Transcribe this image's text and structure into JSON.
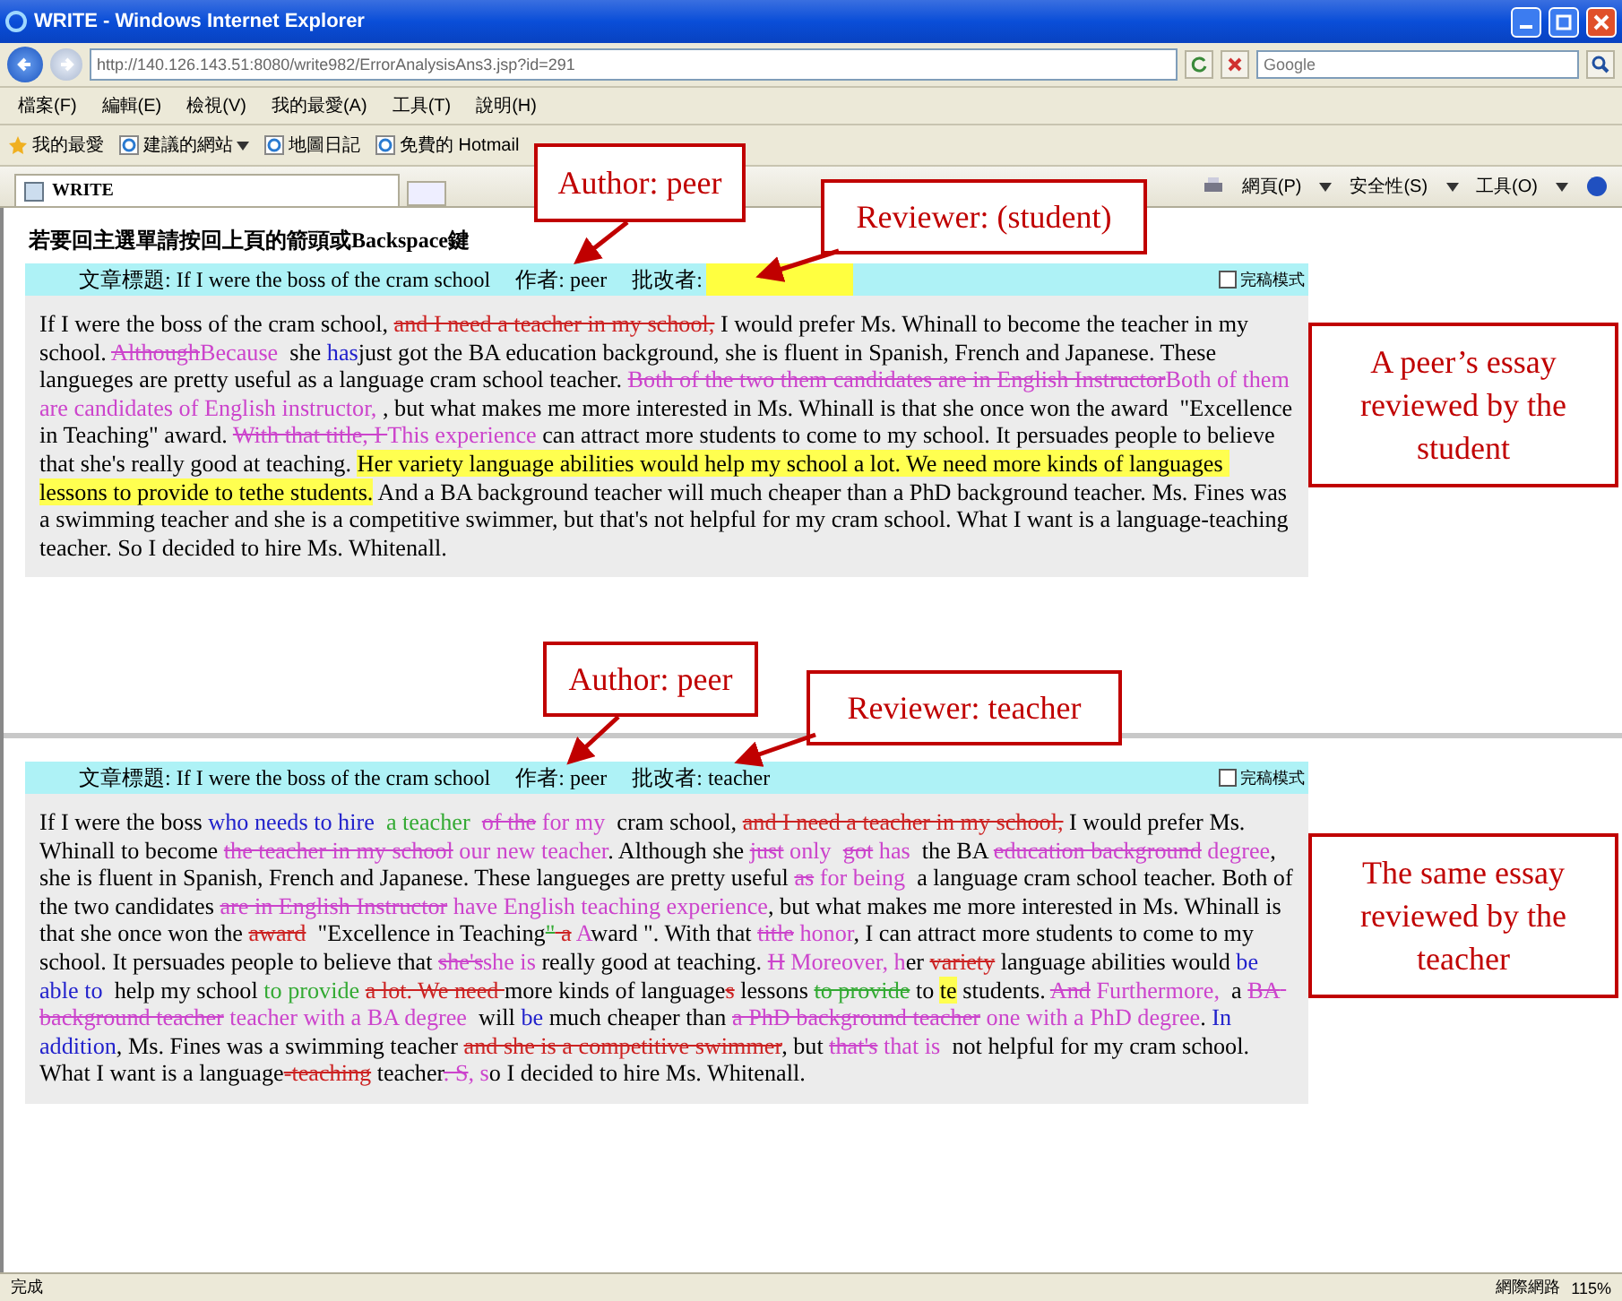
{
  "window": {
    "title": "WRITE - Windows Internet Explorer"
  },
  "address_bar": {
    "url": "http://140.126.143.51:8080/write982/ErrorAnalysisAns3.jsp?id=291"
  },
  "search": {
    "placeholder": "Google"
  },
  "menu": [
    "檔案(F)",
    "編輯(E)",
    "檢視(V)",
    "我的最愛(A)",
    "工具(T)",
    "說明(H)"
  ],
  "favorites": {
    "label": "我的最愛",
    "links": [
      {
        "label": "建議的網站",
        "dropdown": true
      },
      {
        "label": "地圖日記",
        "dropdown": false
      },
      {
        "label": "免費的 Hotmail",
        "dropdown": false
      }
    ]
  },
  "tabs": [
    {
      "label": "WRITE",
      "selected": true
    }
  ],
  "command_bar": [
    "網頁(P)",
    "安全性(S)",
    "工具(O)"
  ],
  "page": {
    "notice": "若要回主選單請按回上頁的箭頭或Backspace鍵",
    "panels": [
      {
        "title_label": "文章標題:",
        "title": "If I were the boss of the cram school",
        "author_label": "作者:",
        "author": "peer",
        "reviewer_label": "批改者:",
        "reviewer_highlighted": true,
        "checkbox": {
          "label": "完稿模式",
          "checked": false
        },
        "essay": [
          {
            "kind": "plain",
            "text": "If I were the boss of the cram school, "
          },
          {
            "kind": "deleted",
            "color": "#cc2222",
            "text": "and I need a teacher in my school,"
          },
          {
            "kind": "plain",
            "text": " I would prefer Ms. Whinall to become the teacher in my school. "
          },
          {
            "kind": "deleted",
            "color": "#cc44cc",
            "text": "Although"
          },
          {
            "kind": "inserted",
            "color": "#cc44cc",
            "text": "Because"
          },
          {
            "kind": "plain",
            "text": "  she "
          },
          {
            "kind": "inserted",
            "color": "#2222cc",
            "text": "has"
          },
          {
            "kind": "plain",
            "text": "just got the BA education background, she is fluent in Spanish, French and Japanese. These langueges are pretty useful as a language cram school teacher. "
          },
          {
            "kind": "deleted",
            "color": "#cc44cc",
            "text": "Both of the two them candidates are in English Instructor"
          },
          {
            "kind": "inserted",
            "color": "#cc44cc",
            "text": "Both of them are candidates of English instructor, "
          },
          {
            "kind": "plain",
            "text": ", but what makes me more interested in Ms. Whinall is that she once won the award  \"Excellence in Teaching\" award. "
          },
          {
            "kind": "deleted",
            "color": "#cc44cc",
            "text": "With that title, I "
          },
          {
            "kind": "inserted",
            "color": "#cc44cc",
            "text": "This experience"
          },
          {
            "kind": "plain",
            "text": " can attract more students to come to my school. It persuades people to believe that she's really good at teaching. "
          },
          {
            "kind": "highlight",
            "text": "Her variety language abilities would help my school a lot. We need more kinds of languages lessons to provide to tethe students."
          },
          {
            "kind": "plain",
            "text": " And a BA background teacher will much cheaper than a PhD background teacher. Ms. Fines was a swimming teacher and she is a competitive swimmer, but that's not helpful for my cram school. What I want is a language-teaching teacher. So I decided to hire Ms. Whitenall."
          }
        ]
      },
      {
        "title_label": "文章標題:",
        "title": "If I were the boss of the cram school",
        "author_label": "作者:",
        "author": "peer",
        "reviewer_label": "批改者:",
        "reviewer": "teacher",
        "reviewer_highlighted": false,
        "checkbox": {
          "label": "完稿模式",
          "checked": false
        },
        "essay": [
          {
            "kind": "plain",
            "text": "If I were the boss "
          },
          {
            "kind": "inserted",
            "color": "#2222cc",
            "text": "who needs to hire"
          },
          {
            "kind": "inserted",
            "color": "#33aa33",
            "text": "  a teacher  "
          },
          {
            "kind": "deleted",
            "color": "#cc44cc",
            "text": "of the"
          },
          {
            "kind": "inserted",
            "color": "#cc44cc",
            "text": " for my"
          },
          {
            "kind": "plain",
            "text": "  cram school, "
          },
          {
            "kind": "deleted",
            "color": "#cc2222",
            "text": "and I need a teacher in my school,"
          },
          {
            "kind": "plain",
            "text": " I would prefer Ms. Whinall to become "
          },
          {
            "kind": "deleted",
            "color": "#cc44cc",
            "text": "the teacher in my school"
          },
          {
            "kind": "inserted",
            "color": "#cc44cc",
            "text": " our new teacher"
          },
          {
            "kind": "plain",
            "text": ". Although she "
          },
          {
            "kind": "deleted",
            "color": "#cc44cc",
            "text": "just"
          },
          {
            "kind": "inserted",
            "color": "#cc44cc",
            "text": " only  "
          },
          {
            "kind": "deleted",
            "color": "#cc44cc",
            "text": "got"
          },
          {
            "kind": "inserted",
            "color": "#cc44cc",
            "text": " has"
          },
          {
            "kind": "plain",
            "text": "  the BA "
          },
          {
            "kind": "deleted",
            "color": "#cc44cc",
            "text": "education background"
          },
          {
            "kind": "inserted",
            "color": "#cc44cc",
            "text": " degree"
          },
          {
            "kind": "plain",
            "text": ", she is fluent in Spanish, French and Japanese. These langueges are pretty useful "
          },
          {
            "kind": "deleted",
            "color": "#cc44cc",
            "text": "as"
          },
          {
            "kind": "inserted",
            "color": "#cc44cc",
            "text": " for being"
          },
          {
            "kind": "plain",
            "text": "  a language cram school teacher. Both of the two candidates "
          },
          {
            "kind": "deleted",
            "color": "#cc44cc",
            "text": "are in English Instructor"
          },
          {
            "kind": "inserted",
            "color": "#cc44cc",
            "text": " have English teaching experience"
          },
          {
            "kind": "plain",
            "text": ", but what makes me more interested in Ms. Whinall is that she once won the "
          },
          {
            "kind": "deleted",
            "color": "#cc2222",
            "text": "award"
          },
          {
            "kind": "plain",
            "text": "  \"Excellence in Teaching"
          },
          {
            "kind": "deleted",
            "color": "#33aa33",
            "text": "\""
          },
          {
            "kind": "deleted",
            "color": "#cc2222",
            "text": " a"
          },
          {
            "kind": "inserted",
            "color": "#cc44cc",
            "text": " A"
          },
          {
            "kind": "plain",
            "text": "ward \". With that "
          },
          {
            "kind": "deleted",
            "color": "#cc44cc",
            "text": "title"
          },
          {
            "kind": "inserted",
            "color": "#cc44cc",
            "text": " honor"
          },
          {
            "kind": "plain",
            "text": ", I can attract more students to come to my school. It persuades people to believe that "
          },
          {
            "kind": "deleted",
            "color": "#cc44cc",
            "text": "she's"
          },
          {
            "kind": "inserted",
            "color": "#cc44cc",
            "text": "she is"
          },
          {
            "kind": "plain",
            "text": " really good at teaching. "
          },
          {
            "kind": "deleted",
            "color": "#cc44cc",
            "text": "H"
          },
          {
            "kind": "inserted",
            "color": "#cc44cc",
            "text": " Moreover, h"
          },
          {
            "kind": "plain",
            "text": "er "
          },
          {
            "kind": "deleted",
            "color": "#cc2222",
            "text": "variety"
          },
          {
            "kind": "plain",
            "text": " language abilities would "
          },
          {
            "kind": "inserted",
            "color": "#2222cc",
            "text": "be able to"
          },
          {
            "kind": "plain",
            "text": "  help my school "
          },
          {
            "kind": "inserted",
            "color": "#33aa33",
            "text": "to provide "
          },
          {
            "kind": "deleted",
            "color": "#cc2222",
            "text": "a lot. We need "
          },
          {
            "kind": "plain",
            "text": "more kinds of language"
          },
          {
            "kind": "deleted",
            "color": "#cc2222",
            "text": "s"
          },
          {
            "kind": "plain",
            "text": " lessons "
          },
          {
            "kind": "deleted",
            "color": "#33aa33",
            "text": "to provide"
          },
          {
            "kind": "plain",
            "text": " to "
          },
          {
            "kind": "highlight",
            "text": "te"
          },
          {
            "kind": "plain",
            "text": " students. "
          },
          {
            "kind": "deleted",
            "color": "#cc44cc",
            "text": "And"
          },
          {
            "kind": "inserted",
            "color": "#cc44cc",
            "text": " Furthermore, "
          },
          {
            "kind": "plain",
            "text": " a "
          },
          {
            "kind": "deleted",
            "color": "#cc44cc",
            "text": "BA background teacher"
          },
          {
            "kind": "inserted",
            "color": "#cc44cc",
            "text": " teacher with a BA degree"
          },
          {
            "kind": "plain",
            "text": "  will "
          },
          {
            "kind": "inserted",
            "color": "#2222cc",
            "text": "be"
          },
          {
            "kind": "plain",
            "text": " much cheaper than "
          },
          {
            "kind": "deleted",
            "color": "#cc44cc",
            "text": "a PhD background teacher"
          },
          {
            "kind": "inserted",
            "color": "#cc44cc",
            "text": " one with a PhD degree"
          },
          {
            "kind": "plain",
            "text": ". "
          },
          {
            "kind": "inserted",
            "color": "#2222cc",
            "text": "In addition"
          },
          {
            "kind": "plain",
            "text": ", Ms. Fines was a swimming teacher "
          },
          {
            "kind": "deleted",
            "color": "#cc2222",
            "text": "and she is a competitive swimmer"
          },
          {
            "kind": "plain",
            "text": ", but "
          },
          {
            "kind": "deleted",
            "color": "#cc44cc",
            "text": "that's"
          },
          {
            "kind": "inserted",
            "color": "#cc44cc",
            "text": " that is"
          },
          {
            "kind": "plain",
            "text": "  not helpful for my cram school. What I want is a language"
          },
          {
            "kind": "deleted",
            "color": "#cc2222",
            "text": "-teaching"
          },
          {
            "kind": "plain",
            "text": " teacher"
          },
          {
            "kind": "deleted",
            "color": "#cc44cc",
            "text": ". S"
          },
          {
            "kind": "inserted",
            "color": "#cc44cc",
            "text": ", s"
          },
          {
            "kind": "plain",
            "text": "o I decided to hire Ms. Whitenall."
          }
        ]
      }
    ]
  },
  "annotations": [
    {
      "text": "Author: peer"
    },
    {
      "text": "Reviewer: (student)"
    },
    {
      "text": "A peer’s essay reviewed by the student"
    },
    {
      "text": "Author: peer"
    },
    {
      "text": "Reviewer: teacher"
    },
    {
      "text": "The same essay reviewed by the teacher"
    }
  ],
  "status_bar": {
    "status": "完成",
    "zone": "網際網路",
    "zoom": "115%"
  }
}
